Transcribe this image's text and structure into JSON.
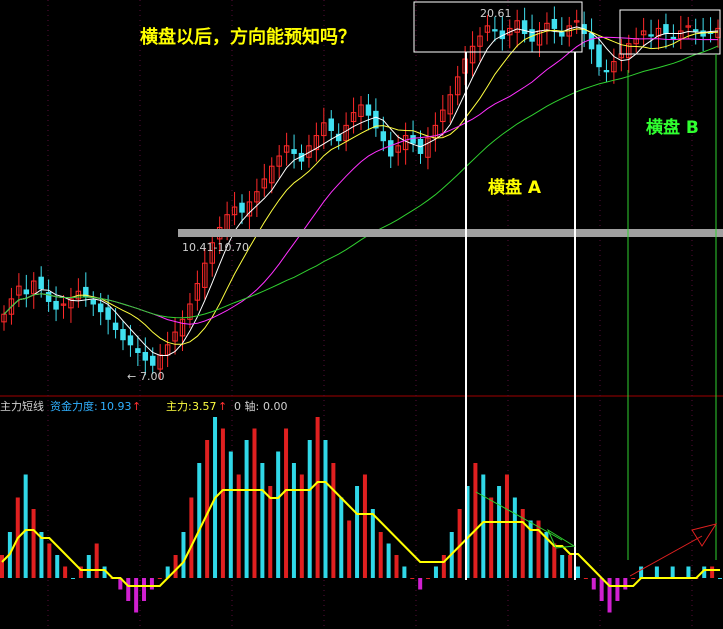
{
  "annotations": {
    "question": "横盘以后，方向能预知吗？",
    "zone_a": "横盘 A",
    "zone_b": "横盘 B",
    "high_label": "20.61",
    "low_label": "7.00",
    "band_label": "10.41-10.70"
  },
  "indicator_header": {
    "name": "主力短线",
    "fund_strength_label": "资金力度:",
    "fund_strength_value": "10.93",
    "main_force_label": "主力:",
    "main_force_value": "3.57",
    "axis_label": "0 轴:",
    "axis_value": "0.00",
    "up_arrow": "↑"
  },
  "colors": {
    "up": "#ff2a2a",
    "down": "#40e0f0",
    "ma_short": "#ffffff",
    "ma_mid": "#ffff40",
    "ma_long": "#ff30ff",
    "ma_longest": "#30d030",
    "osc_line": "#ffff00",
    "hist_up": "#e02020",
    "hist_cyan": "#30d8e8",
    "hist_neg": "#d020d0",
    "title_yellow": "#ffff00",
    "green_text": "#30ff30",
    "divider": "#a00000"
  },
  "chart_data": {
    "type": "candlestick+histogram",
    "price_panel": {
      "low_marker": 7.0,
      "high_marker": 20.61,
      "support_band": [
        10.41,
        10.7
      ],
      "closes": [
        9.0,
        9.6,
        10.1,
        9.8,
        10.3,
        10.0,
        9.5,
        9.2,
        9.4,
        9.6,
        9.9,
        9.7,
        9.4,
        9.1,
        8.8,
        8.4,
        8.0,
        7.8,
        7.5,
        7.2,
        7.0,
        7.4,
        7.8,
        8.3,
        8.8,
        9.4,
        10.2,
        11.0,
        11.8,
        12.4,
        12.9,
        13.2,
        13.0,
        13.4,
        13.8,
        14.3,
        14.8,
        15.2,
        15.6,
        15.3,
        15.0,
        15.6,
        16.0,
        16.5,
        16.2,
        15.8,
        16.4,
        16.9,
        17.2,
        16.8,
        16.3,
        15.8,
        15.2,
        15.6,
        16.0,
        15.7,
        15.3,
        15.9,
        16.4,
        17.0,
        17.6,
        18.3,
        19.0,
        19.5,
        19.9,
        20.3,
        20.1,
        19.8,
        20.2,
        20.5,
        20.0,
        19.7,
        20.1,
        20.4,
        20.2,
        19.9,
        20.3,
        20.5,
        20.0,
        19.4,
        18.7,
        18.5,
        18.9,
        19.2,
        19.6,
        19.8,
        20.1,
        19.9,
        20.2,
        20.0,
        19.8,
        20.1,
        20.3,
        20.1,
        19.9,
        20.0,
        20.2
      ]
    },
    "indicator_panel": {
      "histogram": [
        2,
        4,
        7,
        9,
        6,
        4,
        3,
        2,
        1,
        0,
        1,
        2,
        3,
        1,
        0,
        -1,
        -2,
        -3,
        -2,
        -1,
        0,
        1,
        2,
        4,
        7,
        10,
        12,
        14,
        13,
        11,
        9,
        12,
        13,
        10,
        8,
        11,
        13,
        10,
        9,
        12,
        14,
        12,
        10,
        7,
        5,
        8,
        9,
        6,
        4,
        3,
        2,
        1,
        0,
        -1,
        0,
        1,
        2,
        4,
        6,
        8,
        10,
        9,
        7,
        8,
        9,
        7,
        6,
        5,
        5,
        4,
        3,
        2,
        2,
        1,
        0,
        -1,
        -2,
        -3,
        -2,
        -1,
        0,
        1,
        0,
        1,
        0,
        1,
        0,
        1,
        0,
        1,
        1,
        0
      ],
      "signal_line": [
        2,
        3,
        5,
        6,
        6,
        5,
        5,
        4,
        3,
        2,
        1,
        1,
        1,
        1,
        0,
        0,
        -1,
        -1,
        -1,
        -1,
        -1,
        0,
        1,
        2,
        4,
        6,
        8,
        10,
        11,
        11,
        11,
        11,
        11,
        11,
        10,
        10,
        11,
        11,
        11,
        11,
        12,
        12,
        11,
        10,
        9,
        8,
        8,
        8,
        7,
        6,
        5,
        4,
        3,
        2,
        2,
        2,
        2,
        3,
        4,
        5,
        6,
        7,
        7,
        7,
        7,
        7,
        7,
        6,
        6,
        5,
        4,
        4,
        3,
        3,
        2,
        1,
        0,
        -1,
        -1,
        -1,
        -1,
        0,
        0,
        0,
        0,
        0,
        0,
        0,
        0,
        1,
        1,
        1
      ]
    }
  }
}
